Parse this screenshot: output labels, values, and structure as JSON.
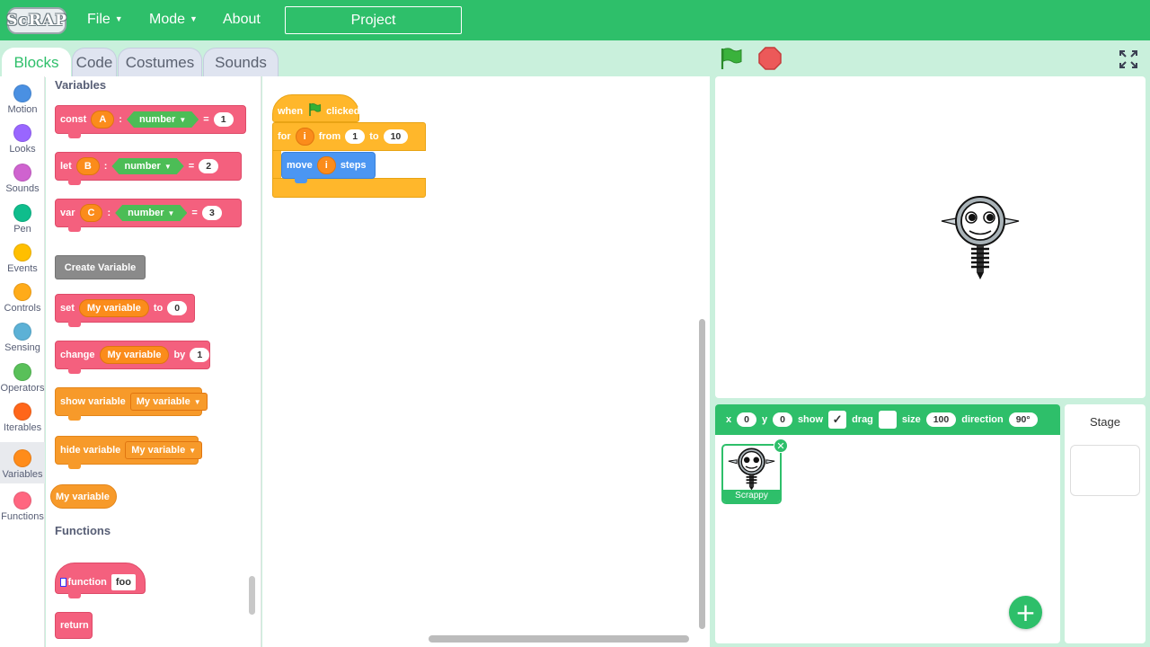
{
  "header": {
    "logo_text": "ScRAP",
    "menu": {
      "file": "File",
      "mode": "Mode",
      "about": "About"
    },
    "project_name": "Project"
  },
  "tabs": [
    "Blocks",
    "Code",
    "Costumes",
    "Sounds"
  ],
  "categories": [
    {
      "label": "Motion",
      "color": "#4a90e2"
    },
    {
      "label": "Looks",
      "color": "#9966ff"
    },
    {
      "label": "Sounds",
      "color": "#cf63cf"
    },
    {
      "label": "Pen",
      "color": "#0fbd8c"
    },
    {
      "label": "Events",
      "color": "#ffbf00"
    },
    {
      "label": "Controls",
      "color": "#ffab19"
    },
    {
      "label": "Sensing",
      "color": "#5cb1d6"
    },
    {
      "label": "Operators",
      "color": "#59c059"
    },
    {
      "label": "Iterables",
      "color": "#ff661a"
    },
    {
      "label": "Variables",
      "color": "#ff8c1a"
    },
    {
      "label": "Functions",
      "color": "#ff6680"
    }
  ],
  "palette": {
    "variables_title": "Variables",
    "declarations": [
      {
        "keyword": "const",
        "name": "A",
        "colon": ":",
        "type": "number",
        "eq": "=",
        "value": "1"
      },
      {
        "keyword": "let",
        "name": "B",
        "colon": ":",
        "type": "number",
        "eq": "=",
        "value": "2"
      },
      {
        "keyword": "var",
        "name": "C",
        "colon": ":",
        "type": "number",
        "eq": "=",
        "value": "3"
      }
    ],
    "create_variable": "Create Variable",
    "set_block": {
      "keyword": "set",
      "var": "My variable",
      "to": "to",
      "value": "0"
    },
    "change_block": {
      "keyword": "change",
      "var": "My variable",
      "by": "by",
      "value": "1"
    },
    "show_block": {
      "keyword": "show variable",
      "var": "My variable"
    },
    "hide_block": {
      "keyword": "hide variable",
      "var": "My variable"
    },
    "variable_reporter": "My variable",
    "functions_title": "Functions",
    "function_block": {
      "keyword": "function",
      "name": "foo"
    },
    "return_block": "return"
  },
  "script": {
    "hat": {
      "when": "when",
      "clicked": "clicked"
    },
    "for_loop": {
      "keyword": "for",
      "var": "i",
      "from": "from",
      "start": "1",
      "to": "to",
      "end": "10"
    },
    "move": {
      "keyword": "move",
      "var": "i",
      "steps": "steps"
    }
  },
  "sprite_props": {
    "x_label": "x",
    "x": "0",
    "y_label": "y",
    "y": "0",
    "show_label": "show",
    "show_checked": "✓",
    "drag_label": "drag",
    "size_label": "size",
    "size": "100",
    "direction_label": "direction",
    "direction": "90°"
  },
  "sprites": [
    {
      "name": "Scrappy"
    }
  ],
  "stage_panel": {
    "title": "Stage"
  },
  "colors": {
    "accent": "#2ebf6a",
    "variables": "#f4607e",
    "events": "#ffb72b",
    "motion": "#4b96f2"
  }
}
